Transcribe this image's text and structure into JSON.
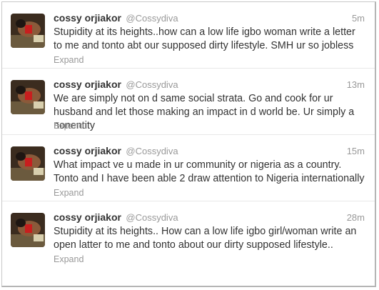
{
  "tweets": [
    {
      "fullname": "cossy orjiakor",
      "username": "@Cossydiva",
      "time": "5m",
      "text": "Stupidity at its heights..how can a low life igbo woman write a letter to me and tonto abt our supposed dirty lifestyle. SMH ur so jobless",
      "expand": "Expand",
      "avatar_icon": "user-photo-avatar"
    },
    {
      "fullname": "cossy orjiakor",
      "username": "@Cossydiva",
      "time": "13m",
      "text": "We are simply not on d same social strata. Go and cook for ur husband and let those making an impact in d world be. Ur simply a nonentity",
      "expand": "Expand",
      "avatar_icon": "user-photo-avatar"
    },
    {
      "fullname": "cossy orjiakor",
      "username": "@Cossydiva",
      "time": "15m",
      "text": "What impact ve u made in ur community or nigeria as a country. Tonto and I have been able 2 draw attention to Nigeria internationally",
      "expand": "Expand",
      "avatar_icon": "user-photo-avatar"
    },
    {
      "fullname": "cossy orjiakor",
      "username": "@Cossydiva",
      "time": "28m",
      "text": "Stupidity at its heights.. How can a low life igbo girl/woman write an open latter to me and tonto about our dirty supposed lifestyle..",
      "expand": "Expand",
      "avatar_icon": "user-photo-avatar"
    }
  ],
  "colors": {
    "name": "#333333",
    "meta": "#999999",
    "text": "#333333",
    "divider": "#e8e8e8"
  }
}
